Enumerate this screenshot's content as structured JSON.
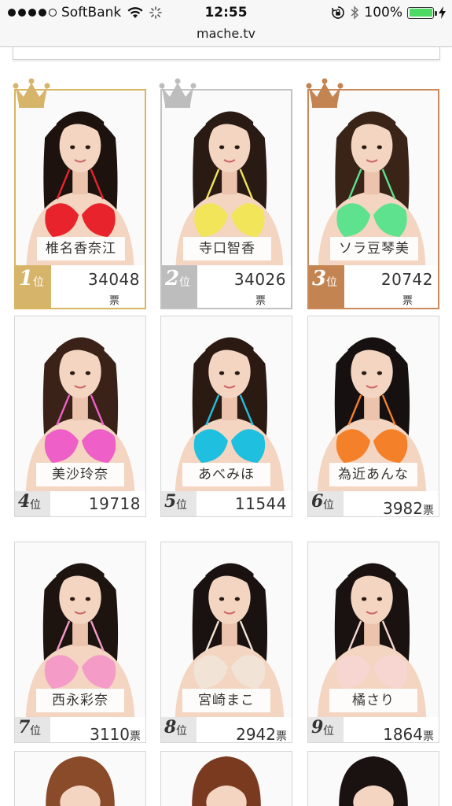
{
  "status_bar": {
    "carrier": "SoftBank",
    "time": "12:55",
    "battery": "100%",
    "signal_bars": 4,
    "battery_level": 1.0
  },
  "url": "mache.tv",
  "colors": {
    "gold": "#d6b46a",
    "silver": "#bdbdbd",
    "bronze": "#c38452",
    "battery": "#4cd964"
  },
  "rank_unit": "位",
  "vote_unit": "票",
  "rankings": [
    {
      "rank": "1",
      "name": "椎名香奈江",
      "votes": "34048",
      "bikini": "#e8232b",
      "hair": "#1d120e",
      "crown": "gold"
    },
    {
      "rank": "2",
      "name": "寺口智香",
      "votes": "34026",
      "bikini": "#f2e55a",
      "hair": "#2a1a14",
      "crown": "silver"
    },
    {
      "rank": "3",
      "name": "ソラ豆琴美",
      "votes": "20742",
      "bikini": "#5ee28e",
      "hair": "#3a2418",
      "crown": "bronze"
    },
    {
      "rank": "4",
      "name": "美沙玲奈",
      "votes": "19718",
      "bikini": "#ee5fc8",
      "hair": "#3a2218"
    },
    {
      "rank": "5",
      "name": "あべみほ",
      "votes": "11544",
      "bikini": "#1fc0df",
      "hair": "#2b1a12"
    },
    {
      "rank": "6",
      "name": "為近あんな",
      "votes": "3982",
      "bikini": "#f4802a",
      "hair": "#161010"
    },
    {
      "rank": "7",
      "name": "西永彩奈",
      "votes": "3110",
      "bikini": "#f59bc8",
      "hair": "#1d1410"
    },
    {
      "rank": "8",
      "name": "宮崎まこ",
      "votes": "2942",
      "bikini": "#f1e4d6",
      "hair": "#1a1210"
    },
    {
      "rank": "9",
      "name": "橘さり",
      "votes": "1864",
      "bikini": "#f7d6d1",
      "hair": "#1a1210"
    }
  ]
}
